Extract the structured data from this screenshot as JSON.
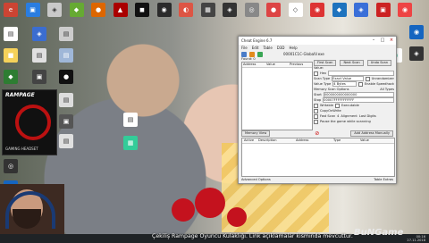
{
  "wallpaper": {
    "desktop_icons_top": [
      {
        "label": "Edge",
        "icon": "browser-icon",
        "color": "#c43"
      },
      {
        "label": "",
        "icon": "app-icon",
        "color": "#2a7de1"
      },
      {
        "label": "",
        "icon": "app-icon",
        "color": "#c9c9c9"
      },
      {
        "label": "",
        "icon": "app-icon",
        "color": "#6a3"
      },
      {
        "label": "",
        "icon": "app-icon",
        "color": "#d60"
      },
      {
        "label": "",
        "icon": "app-icon",
        "color": "#a00"
      },
      {
        "label": "",
        "icon": "app-icon",
        "color": "#111"
      },
      {
        "label": "",
        "icon": "app-icon",
        "color": "#2b2b2b"
      },
      {
        "label": "",
        "icon": "app-icon",
        "color": "#d54"
      },
      {
        "label": "",
        "icon": "app-icon",
        "color": "#444"
      },
      {
        "label": "",
        "icon": "app-icon",
        "color": "#333"
      },
      {
        "label": "",
        "icon": "app-icon",
        "color": "#888"
      },
      {
        "label": "",
        "icon": "app-icon",
        "color": "#d44"
      },
      {
        "label": "",
        "icon": "app-icon",
        "color": "#fff"
      },
      {
        "label": "",
        "icon": "app-icon",
        "color": "#d33"
      },
      {
        "label": "",
        "icon": "app-icon",
        "color": "#1e73be"
      },
      {
        "label": "",
        "icon": "app-icon",
        "color": "#3a6fd8"
      },
      {
        "label": "",
        "icon": "app-icon",
        "color": "#c22"
      },
      {
        "label": "",
        "icon": "app-icon",
        "color": "#e44"
      }
    ],
    "ad_logo": "RAMPAGE",
    "ad_text": "GAMING HEADSET"
  },
  "window": {
    "title": "Cheat Engine 6.7",
    "process": "00001C1C-GlobalV.exe",
    "menu": [
      "File",
      "Edit",
      "Table",
      "D3D",
      "Help"
    ],
    "grid_headers": [
      "Address",
      "Value",
      "Previous"
    ],
    "found_label": "Found: 0",
    "first_scan": "First Scan",
    "next_scan": "Next Scan",
    "undo_scan": "Undo Scan",
    "value_label": "Value:",
    "hex_label": "Hex",
    "scan_type_label": "Scan Type",
    "scan_type_value": "Exact Value",
    "value_type_label": "Value Type",
    "value_type_value": "4 Bytes",
    "memory_scan_options": "Memory Scan Options",
    "start_label": "Start",
    "start_value": "0000000000000000",
    "stop_label": "Stop",
    "stop_value": "00007FFFFFFFFFFF",
    "writable": "Writable",
    "executable": "Executable",
    "copy_on_write": "CopyOnWrite",
    "fast_scan": "Fast Scan",
    "fast_scan_value": "4",
    "alignment": "Alignment",
    "last_digits": "Last Digits",
    "pause_game": "Pause the game while scanning",
    "unrandomizer": "Unrandomizer",
    "speedhack": "Enable Speedhack",
    "all_types": "All Types",
    "memory_view": "Memory View",
    "add_address": "Add Address Manually",
    "addr_headers": [
      "Active",
      "Description",
      "Address",
      "Type",
      "Value"
    ],
    "advanced_options": "Advanced Options",
    "table_extras": "Table Extras"
  },
  "overlay": {
    "ticker": "Çekiliş Rampage Oyuncu Kulaklığı. Link açıklamalar kısmında mevcuttur.",
    "brand": "BuNGame"
  },
  "taskbar": {
    "time": "00:16",
    "date": "27.11.2018"
  }
}
